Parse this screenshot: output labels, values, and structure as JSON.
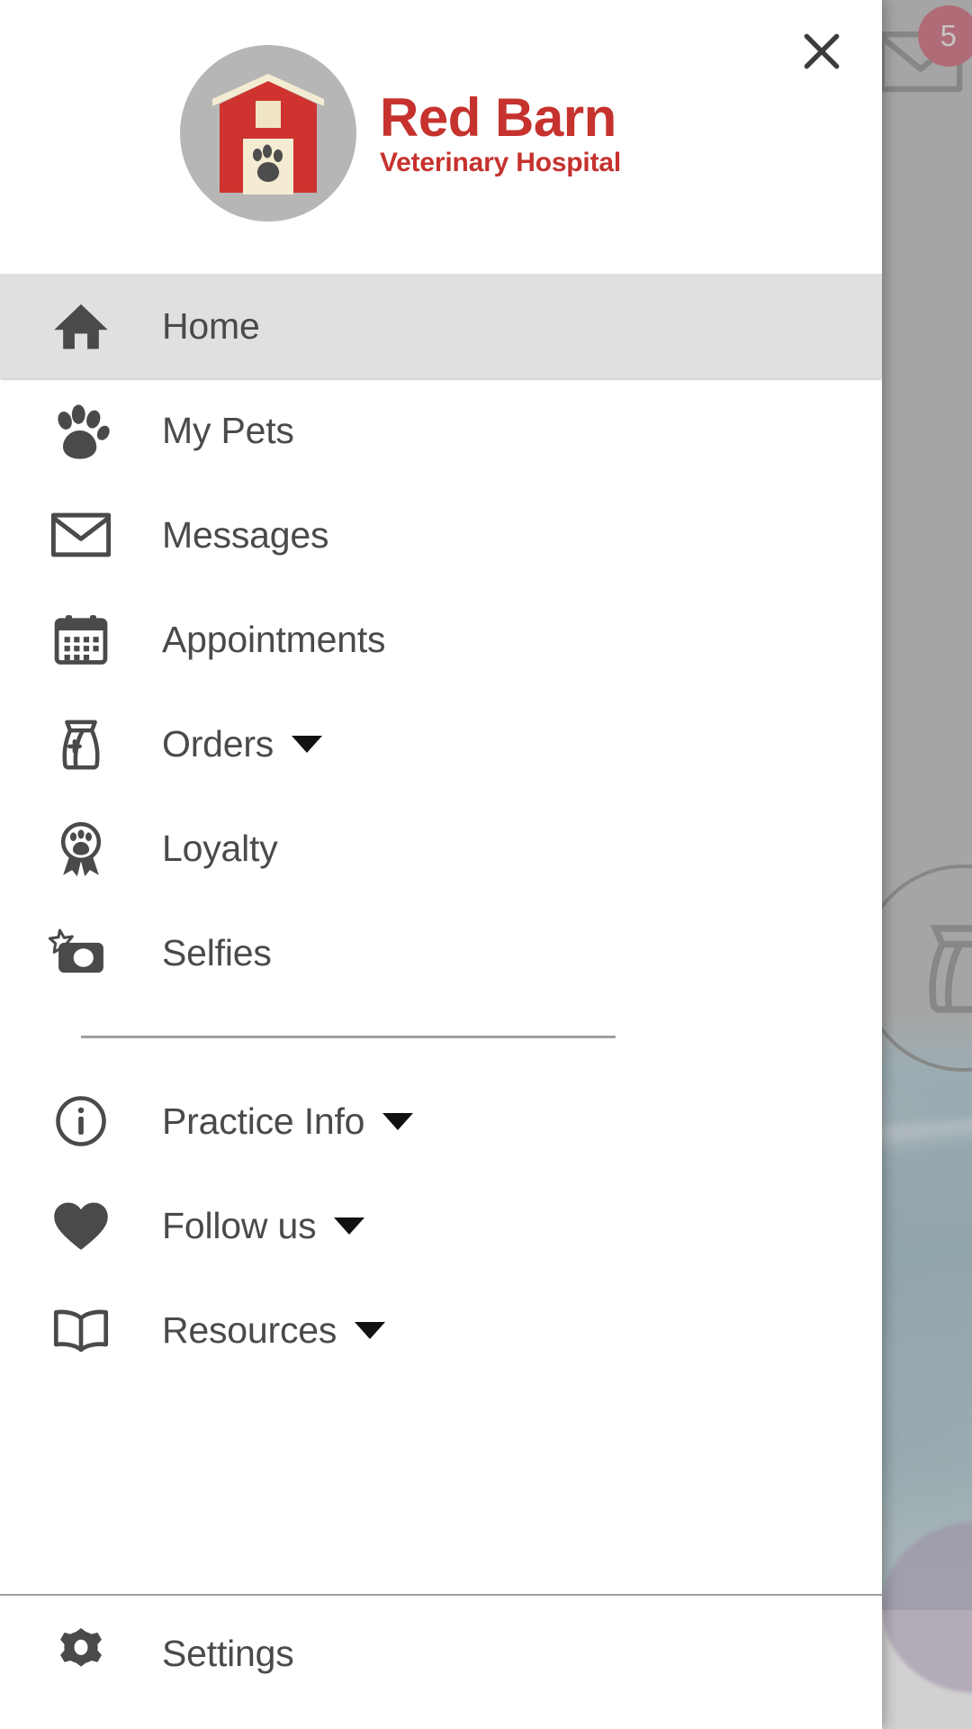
{
  "background": {
    "mail_icon": "mail-icon",
    "mail_badge_count": "5",
    "food_bag_icon": "food-bag-circle-icon"
  },
  "drawer": {
    "close_icon": "close-icon",
    "brand": {
      "logo_icon": "red-barn-logo-icon",
      "title": "Red Barn",
      "subtitle": "Veterinary Hospital",
      "brand_color": "#c6322e",
      "logo_circle_color": "#b6b6b6",
      "barn_color": "#cf3330",
      "roof_color": "#f4ecd2"
    },
    "primary_items": [
      {
        "label": "Home",
        "icon": "home-icon",
        "active": true,
        "has_caret": false
      },
      {
        "label": "My Pets",
        "icon": "paw-icon",
        "active": false,
        "has_caret": false
      },
      {
        "label": "Messages",
        "icon": "envelope-icon",
        "active": false,
        "has_caret": false
      },
      {
        "label": "Appointments",
        "icon": "calendar-icon",
        "active": false,
        "has_caret": false
      },
      {
        "label": "Orders",
        "icon": "food-bag-icon",
        "active": false,
        "has_caret": true
      },
      {
        "label": "Loyalty",
        "icon": "award-paw-icon",
        "active": false,
        "has_caret": false
      },
      {
        "label": "Selfies",
        "icon": "camera-star-icon",
        "active": false,
        "has_caret": false
      }
    ],
    "secondary_items": [
      {
        "label": "Practice Info",
        "icon": "info-circle-icon",
        "has_caret": true
      },
      {
        "label": "Follow us",
        "icon": "heart-icon",
        "has_caret": true
      },
      {
        "label": "Resources",
        "icon": "open-book-icon",
        "has_caret": true
      }
    ],
    "footer_item": {
      "label": "Settings",
      "icon": "gear-icon",
      "has_caret": false
    },
    "active_highlight_color": "#e0e0e0",
    "icon_color": "#4a4a4a",
    "divider_color": "#9e9e9e"
  }
}
